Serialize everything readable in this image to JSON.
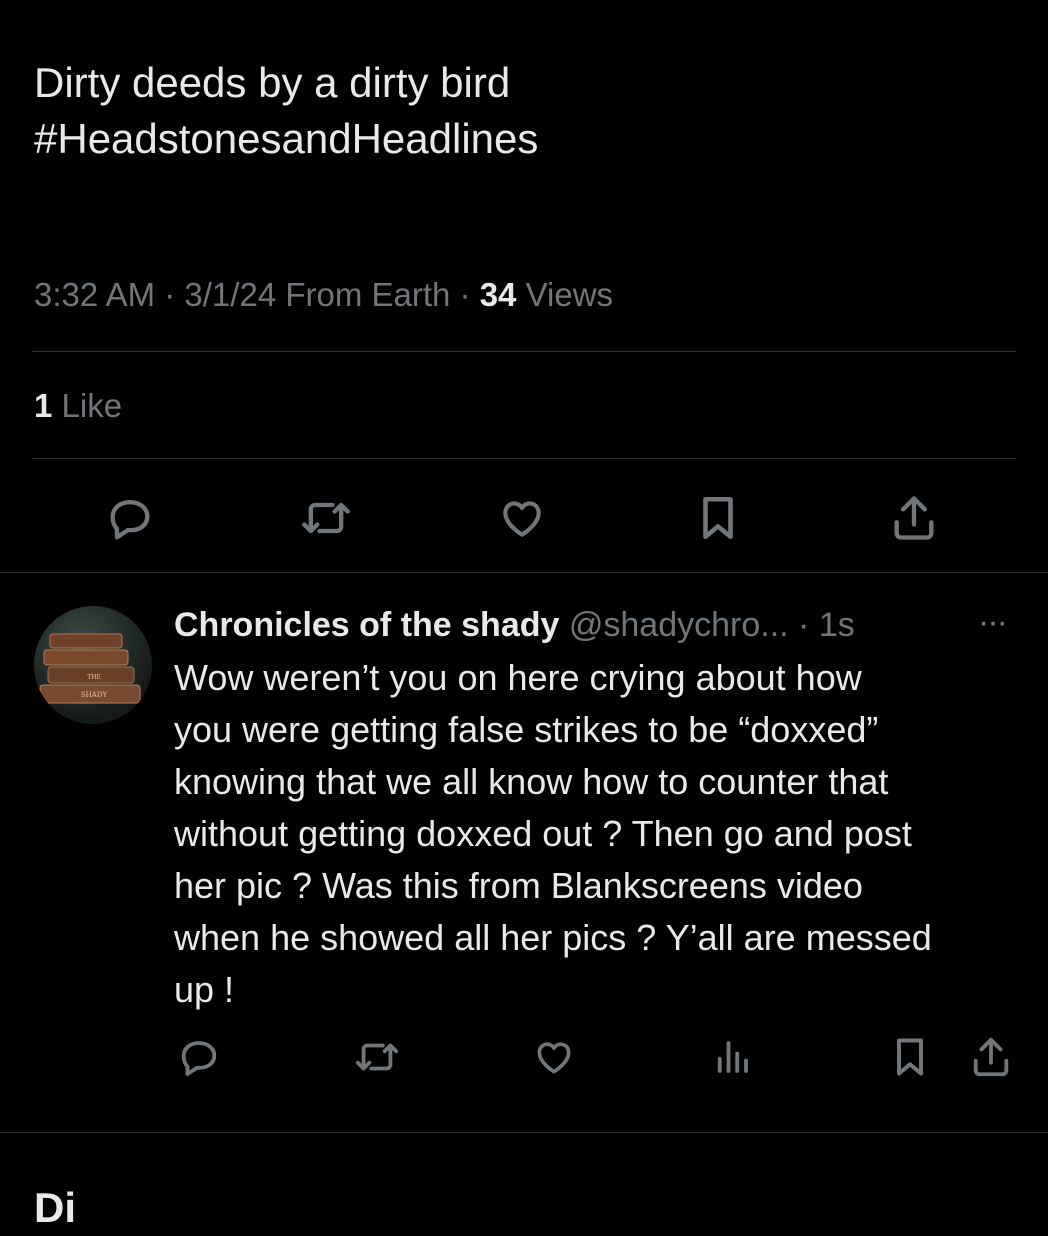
{
  "tweet": {
    "text_lines": [
      "Dirty deeds by a dirty bird",
      "#HeadstonesandHeadlines"
    ],
    "time": "3:32 AM",
    "date": "3/1/24",
    "source": "From Earth",
    "views_count": "34",
    "views_label": "Views",
    "likes_count": "1",
    "likes_label": "Like",
    "actions": [
      "reply-icon",
      "retweet-icon",
      "like-icon",
      "bookmark-icon",
      "share-icon"
    ]
  },
  "reply": {
    "display_name": "Chronicles of the shady",
    "handle": "@shadychro...",
    "time": "1s",
    "more": "···",
    "avatar_text": [
      "THE",
      "SHADY"
    ],
    "text_lines": [
      "Wow weren’t you on here crying about how",
      "you were getting false strikes to be “doxxed”",
      "knowing that we all know how to counter that",
      "without getting doxxed out ? Then go and post",
      "her pic ? Was this from Blankscreens video",
      "when he showed all her pics ? Y’all are messed",
      "up !"
    ],
    "actions": [
      "reply-icon",
      "retweet-icon",
      "like-icon",
      "analytics-icon",
      "bookmark-icon",
      "share-icon"
    ]
  },
  "next_peek": "Di",
  "colors": {
    "background": "#000000",
    "text": "#e7e9ea",
    "secondary": "#71767b",
    "divider": "#2f3336"
  }
}
